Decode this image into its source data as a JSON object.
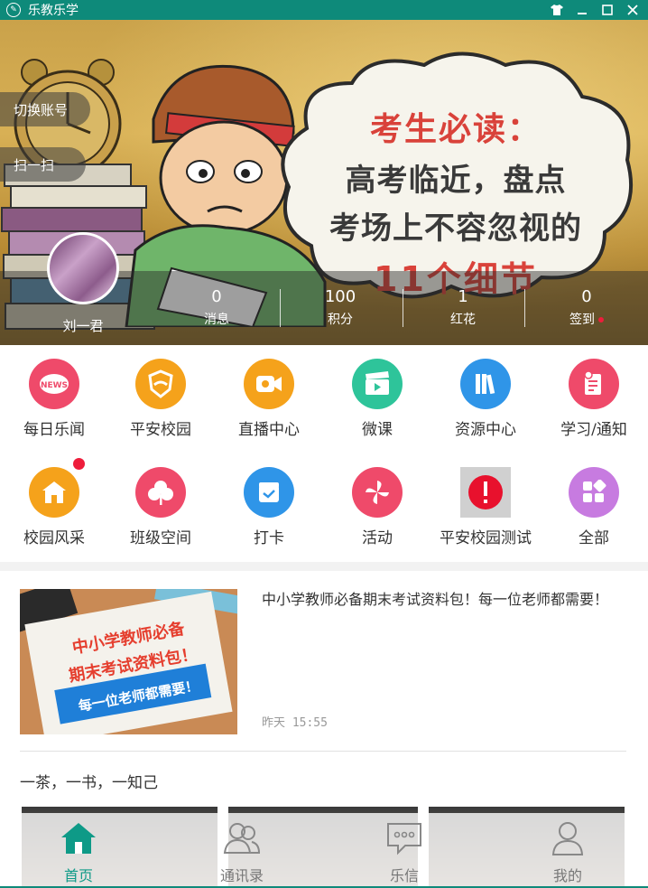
{
  "titlebar": {
    "app_title": "乐教乐学",
    "controls": [
      "shirt-icon",
      "minimize-icon",
      "maximize-icon",
      "close-icon"
    ]
  },
  "banner": {
    "headline_1": "考生必读：",
    "headline_2": "高考临近，盘点",
    "headline_3": "考场上不容忽视的",
    "headline_4": "11个细节",
    "switch_account_label": "切换账号",
    "scan_label": "扫一扫",
    "user_name": "刘一君",
    "stats": [
      {
        "value": "0",
        "label": "消息"
      },
      {
        "value": "100",
        "label": "积分"
      },
      {
        "value": "1",
        "label": "红花"
      },
      {
        "value": "0",
        "label": "签到"
      }
    ]
  },
  "grid": {
    "items": [
      {
        "label": "每日乐闻",
        "icon": "news-icon",
        "color": "#ef4a6a"
      },
      {
        "label": "平安校园",
        "icon": "shield-icon",
        "color": "#f5a21b"
      },
      {
        "label": "直播中心",
        "icon": "video-camera-icon",
        "color": "#f5a21b"
      },
      {
        "label": "微课",
        "icon": "clapperboard-icon",
        "color": "#2ec49a"
      },
      {
        "label": "资源中心",
        "icon": "books-icon",
        "color": "#2f95e8"
      },
      {
        "label": "学习/通知",
        "icon": "notice-icon",
        "color": "#ef4a6a"
      },
      {
        "label": "校园风采",
        "icon": "school-icon",
        "color": "#f5a21b"
      },
      {
        "label": "班级空间",
        "icon": "clover-icon",
        "color": "#ef4a6a"
      },
      {
        "label": "打卡",
        "icon": "checkin-icon",
        "color": "#2f95e8"
      },
      {
        "label": "活动",
        "icon": "pinwheel-icon",
        "color": "#ef4a6a"
      },
      {
        "label": "平安校园测试",
        "icon": "alert-icon",
        "color": "#e8112d"
      },
      {
        "label": "全部",
        "icon": "apps-icon",
        "color": "#c77be0"
      }
    ]
  },
  "news": {
    "thumb_line_1": "中小学教师必备",
    "thumb_line_2": "期末考试资料包！",
    "thumb_line_3": "每一位老师都需要！",
    "title": "中小学教师必备期末考试资料包！每一位老师都需要！",
    "time": "昨天 15:55"
  },
  "section": {
    "title": "一茶，一书，一知己"
  },
  "tabbar": {
    "tabs": [
      {
        "label": "首页",
        "icon": "home-icon"
      },
      {
        "label": "通讯录",
        "icon": "contacts-icon"
      },
      {
        "label": "乐信",
        "icon": "chat-icon"
      },
      {
        "label": "我的",
        "icon": "profile-icon"
      }
    ]
  },
  "colors": {
    "brand": "#0e8a7a",
    "active_tab": "#0e9a87",
    "badge": "#ee1d3b"
  }
}
